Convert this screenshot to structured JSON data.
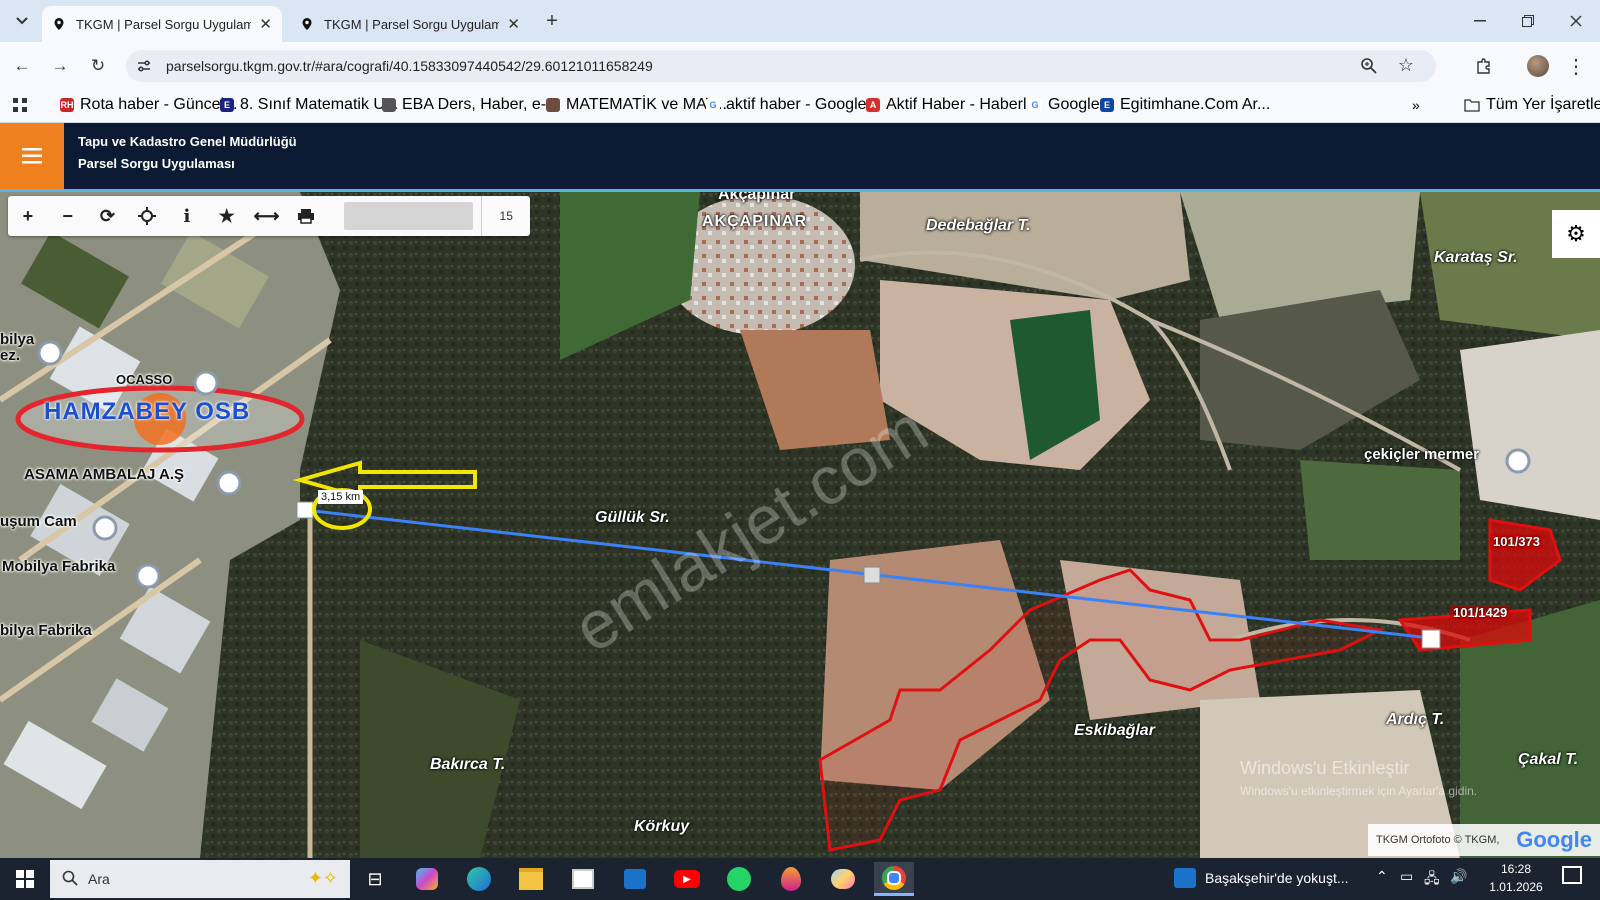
{
  "browser": {
    "tabs": [
      {
        "title": "TKGM | Parsel Sorgu Uygulama",
        "active": true
      },
      {
        "title": "TKGM | Parsel Sorgu Uygulama",
        "active": false
      }
    ],
    "new_tab": "+",
    "url": "parselsorgu.tkgm.gov.tr/#ara/cografi/40.15833097440542/29.60121011658249",
    "bookmarks": [
      {
        "label": "Rota haber - Güncel...",
        "icon": "RH",
        "color": "#c62828"
      },
      {
        "label": "8. Sınıf Matematik U...",
        "icon": "E",
        "color": "#1a237e"
      },
      {
        "label": "EBA Ders, Haber, e-...",
        "icon": "",
        "color": "#555555"
      },
      {
        "label": "MATEMATİK ve MAT...",
        "icon": "",
        "color": "#6d4c41"
      },
      {
        "label": "aktif haber - Google...",
        "icon": "G",
        "color": "#ffffff"
      },
      {
        "label": "Aktif Haber - Haberl...",
        "icon": "A",
        "color": "#d32f2f"
      },
      {
        "label": "Google",
        "icon": "G",
        "color": "#ffffff"
      },
      {
        "label": "Egitimhane.Com Ar...",
        "icon": "E",
        "color": "#0d47a1"
      }
    ],
    "bookmarks_more": "»",
    "all_bookmarks": "Tüm Yer İşaretleri"
  },
  "app": {
    "org_name": "Tapu ve Kadastro Genel Müdürlüğü",
    "app_name": "Parsel Sorgu Uygulaması"
  },
  "map_toolbar": {
    "tools": [
      "zoom-in",
      "zoom-out",
      "refresh",
      "locate",
      "info",
      "favorite",
      "measure",
      "print"
    ],
    "zoom_level": "15"
  },
  "map": {
    "place_labels": [
      {
        "text": "Akçapınar",
        "kind": "place"
      },
      {
        "text": "AKÇAPINAR",
        "kind": "town"
      },
      {
        "text": "Dedebağlar T.",
        "kind": "place"
      },
      {
        "text": "Karataş Sr.",
        "kind": "place"
      },
      {
        "text": "Güllük Sr.",
        "kind": "place"
      },
      {
        "text": "Eskibağlar",
        "kind": "place"
      },
      {
        "text": "Ardıç T.",
        "kind": "place"
      },
      {
        "text": "Çakal T.",
        "kind": "place"
      },
      {
        "text": "Bakırca T.",
        "kind": "place"
      },
      {
        "text": "Körkuy",
        "kind": "place"
      }
    ],
    "poi_labels": [
      {
        "text": "bilya ez.",
        "kind": "poi"
      },
      {
        "text": "OCASSO",
        "kind": "poi"
      },
      {
        "text": "ASAMA AMBALAJ A.Ş",
        "kind": "poi"
      },
      {
        "text": "uşum Cam",
        "kind": "poi"
      },
      {
        "text": "Mobilya Fabrika",
        "kind": "poi"
      },
      {
        "text": "bilya Fabrika",
        "kind": "poi"
      },
      {
        "text": "çekiçler mermer",
        "kind": "poi"
      }
    ],
    "highlight_label": "HAMZABEY OSB",
    "measurement": "3,15 km",
    "parcels": [
      "101/373",
      "101/1429"
    ],
    "watermark": "emlakjet.com",
    "windows_notice_title": "Windows'u Etkinleştir",
    "windows_notice_sub": "Windows'u etkinleştirmek için Ayarlar'a gidin.",
    "attribution": "TKGM Ortofoto © TKGM,",
    "attribution_logo": "Google"
  },
  "taskbar": {
    "search_placeholder": "Ara",
    "news": "Başakşehir'de yokuşt...",
    "time": "16:28",
    "date": "1.01.2026"
  },
  "colors": {
    "header_bg": "#0c1a33",
    "hamburger_bg": "#f07f1e",
    "measure_line": "#3b82f6",
    "parcel_outline": "#e01010",
    "highlight_ellipse": "#e3262e"
  }
}
